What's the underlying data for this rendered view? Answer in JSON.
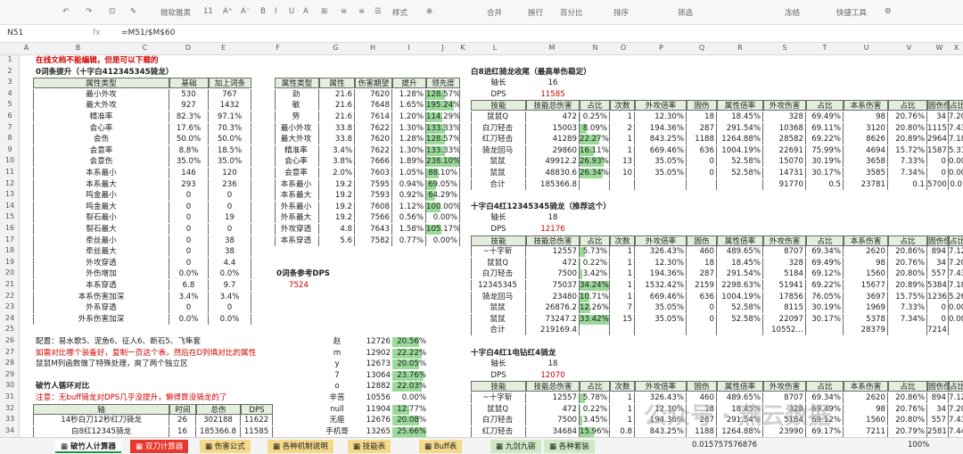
{
  "toolbar": {
    "items": [
      "↶",
      "↷",
      "⊡",
      "✎",
      "微软雅黑",
      "11",
      "A⁺",
      "A⁻",
      "B",
      "I",
      "U",
      "A",
      "⊞",
      "≡",
      "≡",
      "☰",
      "样式",
      "⊕",
      "合并",
      "换行",
      "百分比",
      "排序",
      "筛选",
      "冻结",
      "快捷工具",
      "⚙"
    ]
  },
  "formula_bar": {
    "cell": "N51",
    "fx": "fx",
    "value": "=M51/$M$60"
  },
  "columns": [
    "A",
    "B",
    "C",
    "D",
    "E",
    "F",
    "G",
    "H",
    "I",
    "J",
    "K",
    "L",
    "M",
    "N",
    "O",
    "P",
    "Q",
    "R",
    "S",
    "T",
    "U",
    "V",
    "W",
    "X",
    "Y",
    "Z"
  ],
  "rows": [
    "1",
    "2",
    "3",
    "4",
    "5",
    "6",
    "7",
    "8",
    "9",
    "10",
    "11",
    "12",
    "13",
    "14",
    "15",
    "16",
    "17",
    "18",
    "19",
    "20",
    "21",
    "22",
    "23",
    "24",
    "25",
    "26",
    "27",
    "28",
    "29",
    "30",
    "31",
    "32",
    "33",
    "34"
  ],
  "left": {
    "note": "在线文档不能编辑，但是可以下载的",
    "title": "0词条提升（十字白412345345骑龙）",
    "headers": [
      "属性类型",
      "基础",
      "加上词条"
    ],
    "rows": [
      [
        "最小外攻",
        "530",
        "767"
      ],
      [
        "最大外攻",
        "927",
        "1432"
      ],
      [
        "精准率",
        "82.3%",
        "97.1%"
      ],
      [
        "会心率",
        "17.6%",
        "70.3%"
      ],
      [
        "会伤",
        "50.0%",
        "50.0%"
      ],
      [
        "会意率",
        "8.8%",
        "18.5%"
      ],
      [
        "会意伤",
        "35.0%",
        "35.0%"
      ],
      [
        "本系最小",
        "146",
        "120"
      ],
      [
        "本系最大",
        "293",
        "236"
      ],
      [
        "鸣金最小",
        "0",
        "0"
      ],
      [
        "鸣金最大",
        "0",
        "0"
      ],
      [
        "裂石最小",
        "0",
        "19"
      ],
      [
        "裂石最大",
        "0",
        "0"
      ],
      [
        "牵丝最小",
        "0",
        "38"
      ],
      [
        "牵丝最大",
        "0",
        "38"
      ],
      [
        "外攻穿透",
        "0",
        "4.4"
      ],
      [
        "外伤增加",
        "0.0%",
        "0.0%"
      ],
      [
        "本系穿透",
        "6.8",
        "9.7"
      ],
      [
        "本系伤害加深",
        "3.4%",
        "3.4%"
      ],
      [
        "外系穿透",
        "0",
        "0"
      ],
      [
        "外系伤害加深",
        "0.0%",
        "0.0%"
      ]
    ],
    "config": "配置：易水歌5、泥鱼6、征人6、断石5、飞隼套",
    "config_note": "如需对比哪个装备好，复制一页这个表，然后在D列填对比的属性",
    "config_note2": "鼠鼠M列函数做了特殊处理，爽了两个独立区",
    "cycle_title": "破竹人循环对比",
    "cycle_note": "注意：无buff骑龙对DPS几乎没提升，懒得算没骑龙的了",
    "cycle_headers": [
      "轴",
      "时间",
      "总伤",
      "DPS"
    ],
    "cycle_rows": [
      [
        "14秒白刀12秒红刀骑龙",
        "26",
        "302188",
        "11622"
      ],
      [
        "白8红12345骑龙",
        "16",
        "185366.8",
        "11585"
      ]
    ]
  },
  "mid": {
    "headers": [
      "属性类型",
      "属性",
      "伤害期望",
      "提升",
      "领先度"
    ],
    "rows": [
      [
        "劲",
        "21.6",
        "7620",
        "1.28%",
        "128.57%"
      ],
      [
        "敏",
        "21.6",
        "7648",
        "1.65%",
        "195.24%"
      ],
      [
        "势",
        "21.6",
        "7614",
        "1.20%",
        "114.29%"
      ],
      [
        "最小外攻",
        "33.8",
        "7622",
        "1.30%",
        "133.33%"
      ],
      [
        "最大外攻",
        "33.8",
        "7620",
        "1.28%",
        "128.57%"
      ],
      [
        "精准率",
        "3.4%",
        "7622",
        "1.30%",
        "133.33%"
      ],
      [
        "会心率",
        "3.8%",
        "7666",
        "1.89%",
        "238.10%"
      ],
      [
        "会意率",
        "2.0%",
        "7603",
        "1.05%",
        "88.10%"
      ],
      [
        "本系最小",
        "19.2",
        "7595",
        "0.94%",
        "69.05%"
      ],
      [
        "本系最大",
        "19.2",
        "7593",
        "0.92%",
        "64.29%"
      ],
      [
        "外系最小",
        "19.2",
        "7608",
        "1.12%",
        "100.00%"
      ],
      [
        "外系最大",
        "19.2",
        "7566",
        "0.56%",
        "0.00%"
      ],
      [
        "外攻穿透",
        "4.8",
        "7643",
        "1.58%",
        "105.17%"
      ],
      [
        "本系穿透",
        "5.6",
        "7582",
        "0.77%",
        "0.00%"
      ]
    ],
    "lead_pct": [
      128.57,
      195.24,
      114.29,
      133.33,
      128.57,
      133.33,
      238.1,
      88.1,
      69.05,
      64.29,
      100.0,
      0.0,
      105.17,
      0.0
    ],
    "ref_title": "0词条参考DPS",
    "ref_value": "7524",
    "extra": [
      [
        "赵",
        "12726",
        "20.56%"
      ],
      [
        "m",
        "12902",
        "22.22%"
      ],
      [
        "y",
        "12673",
        "20.05%"
      ],
      [
        "7",
        "13064",
        "23.76%"
      ],
      [
        "o",
        "12882",
        "22.03%"
      ],
      [
        "辛苦",
        "10556",
        "0.00%"
      ],
      [
        "null",
        "11904",
        "12.77%"
      ],
      [
        "无座",
        "12676",
        "20.08%"
      ],
      [
        "手机哥",
        "13265",
        "25.66%"
      ]
    ],
    "extra_pct": [
      20.56,
      22.22,
      20.05,
      23.76,
      22.03,
      0,
      12.77,
      20.08,
      25.66
    ]
  },
  "right": {
    "headers": [
      "技能",
      "技能总伤害",
      "占比",
      "次数",
      "外攻倍率",
      "固伤",
      "属性倍率",
      "外攻伤害",
      "占比",
      "本系伤害",
      "占比",
      "固伤伤害",
      "占比",
      "鸣金",
      "占"
    ],
    "t1": {
      "title": "白8进红骑龙收尾（最高单伤稳定）",
      "axis_label": "轴长",
      "axis": "16",
      "dps_label": "DPS",
      "dps": "11585",
      "rows": [
        [
          "鼠鼠Q",
          "472",
          "0.25%",
          "1",
          "12.30%",
          "18",
          "18.45%",
          "328",
          "69.49%",
          "98",
          "20.76%",
          "34",
          "7.20%",
          "0",
          "0"
        ],
        [
          "白刀轻击",
          "15003",
          "8.09%",
          "2",
          "194.36%",
          "287",
          "291.54%",
          "10368",
          "69.11%",
          "3120",
          "20.80%",
          "1115",
          "7.43%",
          "0",
          "0"
        ],
        [
          "红刀轻击",
          "41289",
          "22.27%",
          "1",
          "843.25%",
          "1188",
          "1264.88%",
          "28582",
          "69.22%",
          "8626",
          "20.89%",
          "2964",
          "7.18%",
          "0",
          "0"
        ],
        [
          "骑龙回马",
          "29860",
          "16.11%",
          "1",
          "669.46%",
          "636",
          "1004.19%",
          "22691",
          "75.99%",
          "4694",
          "15.72%",
          "1587",
          "5.31%",
          "0",
          "0"
        ],
        [
          "鼠鼠",
          "49912.2",
          "26.93%",
          "13",
          "35.05%",
          "0",
          "52.58%",
          "15070",
          "30.19%",
          "3658",
          "7.33%",
          "0",
          "0.00%",
          "0",
          "0"
        ],
        [
          "鼠鼠",
          "48830.6",
          "26.34%",
          "10",
          "35.05%",
          "0",
          "52.58%",
          "14731",
          "30.17%",
          "3585",
          "7.34%",
          "0",
          "0.00%",
          "0",
          "0"
        ],
        [
          "合计",
          "185366.8",
          "",
          "",
          "",
          "",
          "",
          "91770",
          "0.5",
          "23781",
          "0.1",
          "5700",
          "0.0",
          "",
          ""
        ]
      ],
      "pct": [
        0.25,
        8.09,
        22.27,
        16.11,
        26.93,
        26.34
      ]
    },
    "t2": {
      "title": "十字白4红12345345骑龙（推荐这个）",
      "axis_label": "轴长",
      "axis": "18",
      "dps_label": "DPS",
      "dps": "12176",
      "rows": [
        [
          "~十字斩",
          "12557",
          "5.73%",
          "1",
          "326.43%",
          "460",
          "489.65%",
          "8707",
          "69.34%",
          "2620",
          "20.86%",
          "894",
          "7.12%",
          "0",
          "0"
        ],
        [
          "鼠鼠Q",
          "472",
          "0.22%",
          "1",
          "12.30%",
          "18",
          "18.45%",
          "328",
          "69.49%",
          "98",
          "20.76%",
          "34",
          "7.20%",
          "0",
          "0"
        ],
        [
          "白刀轻击",
          "7500",
          "3.42%",
          "1",
          "194.36%",
          "287",
          "291.54%",
          "5184",
          "69.12%",
          "1560",
          "20.80%",
          "557",
          "7.43%",
          "0",
          "0"
        ],
        [
          "12345345",
          "75037",
          "34.24%",
          "1",
          "1532.42%",
          "2159",
          "2298.63%",
          "51941",
          "69.22%",
          "15677",
          "20.89%",
          "5384",
          "7.18%",
          "0",
          "0"
        ],
        [
          "骑龙回马",
          "23480",
          "10.71%",
          "1",
          "669.46%",
          "636",
          "1004.19%",
          "17856",
          "76.05%",
          "3697",
          "15.75%",
          "1236",
          "5.26%",
          "0",
          "0"
        ],
        [
          "鼠鼠",
          "26876.2",
          "12.26%",
          "7",
          "35.05%",
          "0",
          "52.58%",
          "8115",
          "30.19%",
          "1969",
          "7.33%",
          "0",
          "0.00%",
          "0",
          "0"
        ],
        [
          "鼠鼠",
          "73247.2",
          "33.42%",
          "15",
          "35.05%",
          "0",
          "52.58%",
          "22097",
          "30.17%",
          "5378",
          "7.34%",
          "0",
          "0.00%",
          "0",
          "0"
        ],
        [
          "合计",
          "219169.4",
          "",
          "",
          "",
          "",
          "",
          "10552…",
          "",
          "28379",
          "",
          "7214",
          "",
          "",
          ""
        ]
      ],
      "pct": [
        5.73,
        0.22,
        3.42,
        34.24,
        10.71,
        12.26,
        33.42
      ]
    },
    "t3": {
      "title": "十字白4红1电钻红4骑龙",
      "axis_label": "轴长",
      "axis": "18",
      "dps_label": "DPS",
      "dps": "12070",
      "rows": [
        [
          "~十字斩",
          "12557",
          "5.78%",
          "1",
          "326.43%",
          "460",
          "489.65%",
          "8707",
          "69.34%",
          "2620",
          "20.86%",
          "894",
          "7.12%",
          "0",
          "0"
        ],
        [
          "鼠鼠Q",
          "472",
          "0.22%",
          "1",
          "12.30%",
          "18",
          "18.45%",
          "328",
          "69.49%",
          "98",
          "20.76%",
          "34",
          "7.20%",
          "0",
          "0"
        ],
        [
          "白刀轻击",
          "7500",
          "3.45%",
          "1",
          "194.36%",
          "287",
          "291.54%",
          "5184",
          "69.12%",
          "1560",
          "20.80%",
          "557",
          "7.43%",
          "0",
          "0"
        ],
        [
          "红刀轻击",
          "34684",
          "15.96%",
          "0.8",
          "843.25%",
          "1188",
          "1264.88%",
          "23990",
          "69.17%",
          "7211",
          "20.79%",
          "2581",
          "7.44%",
          "0",
          "0"
        ]
      ],
      "pct": [
        5.78,
        0.22,
        3.45,
        15.96
      ]
    }
  },
  "sheets": [
    "破竹人计算器",
    "双刀计算器",
    "伤害公式",
    "各种机制说明",
    "技能表",
    "Buff表",
    "九剑九砺",
    "各种套装"
  ],
  "status": {
    "value": "0.015757576876",
    "zoom": "100%"
  },
  "watermark": "公众号 · 燕云数据"
}
